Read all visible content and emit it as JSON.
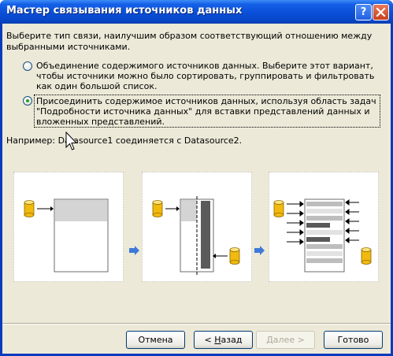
{
  "window": {
    "title": "Мастер связывания источников данных",
    "help_button": "?",
    "close_button": "✕"
  },
  "intro": "Выберите тип связи, наилучшим образом соответствующий отношению между выбранными источниками.",
  "options": [
    {
      "label": "Объединение содержимого источников данных. Выберите этот вариант, чтобы источники можно было сортировать, группировать и фильтровать как один большой список.",
      "selected": false
    },
    {
      "label": "Присоединить содержимое источников данных, используя область задач \"Подробности источника данных\" для вставки представлений данных и вложенных представлений.",
      "selected": true
    }
  ],
  "example_text": "Например: Datasource1 соединяется с Datasource2.",
  "buttons": {
    "cancel": "Отмена",
    "back_prefix": "< ",
    "back_key": "Н",
    "back_rest": "азад",
    "next": "Далее >",
    "finish": "Готово"
  },
  "colors": {
    "titlebar": "#0a4fd8",
    "dialog_bg": "#ece9d8",
    "database": "#f2b90e",
    "arrow": "#3d7ad8",
    "selected_radio": "#21a121"
  }
}
